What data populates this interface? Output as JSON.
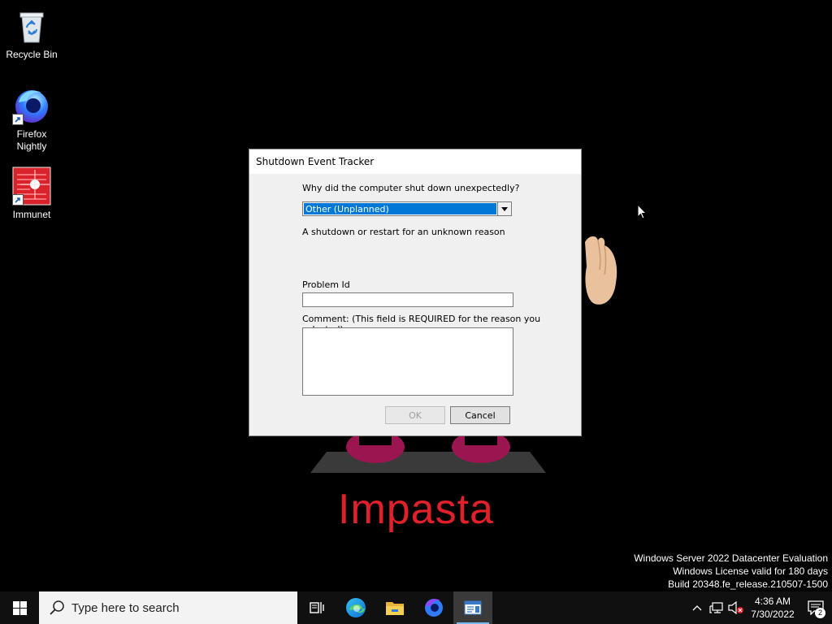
{
  "desktop": {
    "icons": [
      {
        "label": "Recycle Bin",
        "icon": "recycle-bin-icon"
      },
      {
        "label": "Firefox Nightly",
        "icon": "firefox-nightly-icon"
      },
      {
        "label": "Immunet",
        "icon": "immunet-icon"
      }
    ],
    "wallpaper_text": "Impasta",
    "watermark": {
      "line1": "Windows Server 2022 Datacenter Evaluation",
      "line2": "Windows License valid for 180 days",
      "line3": "Build 20348.fe_release.210507-1500"
    }
  },
  "dialog": {
    "title": "Shutdown Event Tracker",
    "question": "Why did the computer shut down unexpectedly?",
    "reason_selected": "Other (Unplanned)",
    "reason_description": "A shutdown or restart for an unknown reason",
    "problem_id_label": "Problem Id",
    "problem_id_value": "",
    "comment_label": "Comment: (This field is REQUIRED for the reason you selected)",
    "comment_value": "",
    "ok_label": "OK",
    "cancel_label": "Cancel"
  },
  "taskbar": {
    "search_placeholder": "Type here to search",
    "apps": [
      "task-view-icon",
      "edge-icon",
      "file-explorer-icon",
      "firefox-nightly-icon",
      "shutdown-event-tracker-icon"
    ],
    "clock_time": "4:36 AM",
    "clock_date": "7/30/2022",
    "notification_count": "2"
  },
  "colors": {
    "desktop_bg": "#000000",
    "wallpaper_text": "#e0202a",
    "selection": "#0078d7",
    "taskbar": "#101010"
  }
}
